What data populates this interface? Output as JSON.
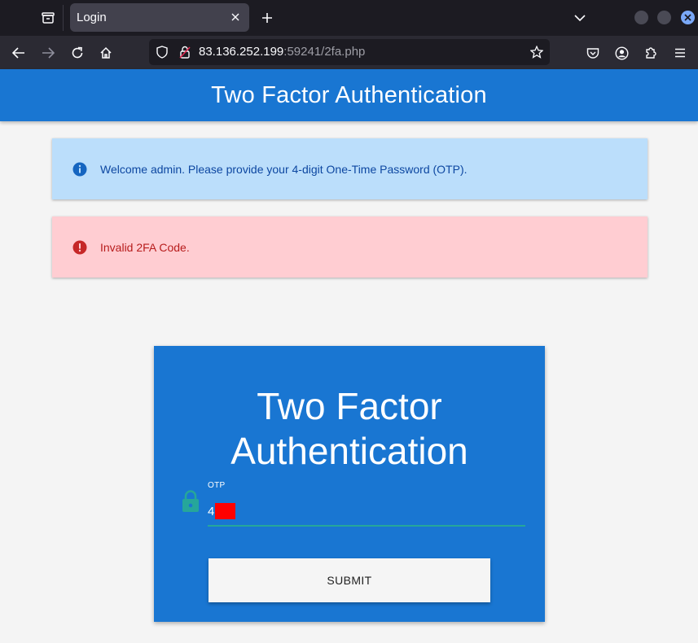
{
  "browser": {
    "tab_title": "Login",
    "url_host": "83.136.252.199",
    "url_rest": ":59241/2fa.php",
    "icons": [
      "tab-list-icon",
      "close-icon",
      "plus-icon",
      "chevron-down-icon",
      "back-icon",
      "forward-icon",
      "reload-icon",
      "home-icon",
      "shield-icon",
      "lock-icon",
      "star-icon",
      "pocket-icon",
      "account-icon",
      "extensions-icon",
      "menu-icon"
    ]
  },
  "page": {
    "header_title": "Two Factor Authentication",
    "info_message": "Welcome admin. Please provide your 4-digit One-Time Password (OTP).",
    "error_message": "Invalid 2FA Code.",
    "card_title": "Two Factor Authentication",
    "otp_label": "OTP",
    "otp_value": "4",
    "submit_label": "SUBMIT"
  },
  "colors": {
    "primary": "#1976d2",
    "info_bg": "#bbdefb",
    "error_bg": "#ffcdd2",
    "input_underline": "#26a69a",
    "redaction": "#ff0000"
  }
}
